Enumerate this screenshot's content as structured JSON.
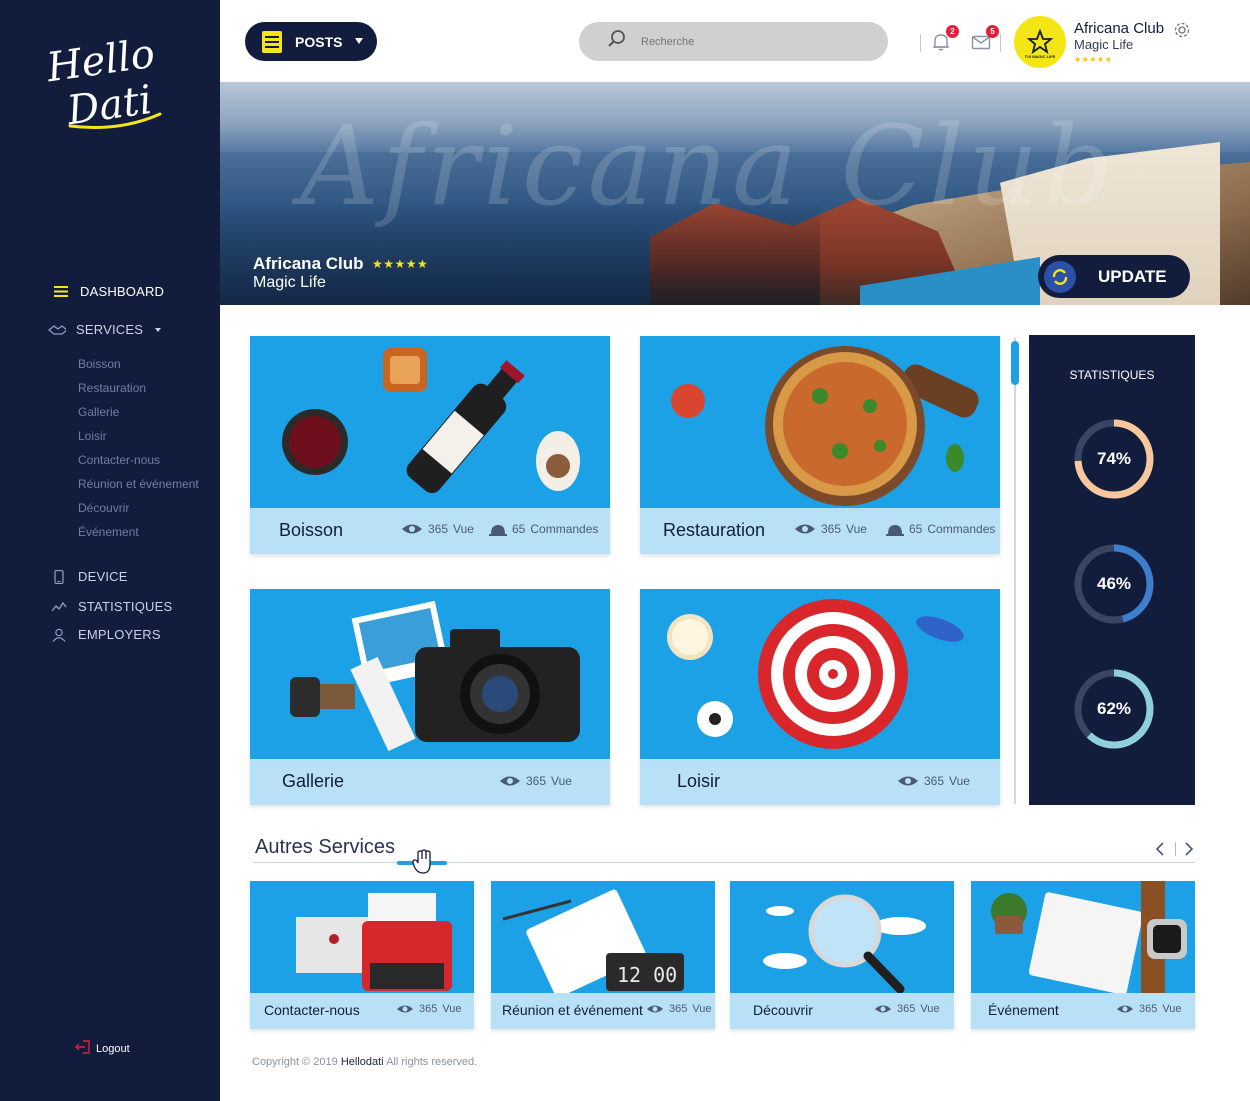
{
  "sidebar": {
    "logo_text": "Hello Dati",
    "nav": [
      {
        "label": "DASHBOARD",
        "icon": "menu-icon"
      },
      {
        "label": "SERVICES",
        "icon": "handshake-icon"
      },
      {
        "label": "DEVICE",
        "icon": "mobile-icon"
      },
      {
        "label": "STATISTIQUES",
        "icon": "chart-line-icon"
      },
      {
        "label": "EMPLOYERS",
        "icon": "user-icon"
      }
    ],
    "services_sub": [
      "Boisson",
      "Restauration",
      "Gallerie",
      "Loisir",
      "Contacter-nous",
      "Réunion et événement",
      "Découvrir",
      "Événement"
    ],
    "logout": "Logout"
  },
  "header": {
    "posts_label": "POSTS",
    "search_placeholder": "Recherche",
    "notifications_count": "2",
    "messages_count": "5",
    "avatar_text": "TUI MAGIC LIFE",
    "club_name": "Africana Club",
    "club_sub": "Magic Life",
    "club_stars": "★★★★★"
  },
  "banner": {
    "watermark": "Africana Club",
    "title": "Africana Club",
    "stars": "★★★★★",
    "subtitle": "Magic Life",
    "update_label": "UPDATE"
  },
  "cards": [
    {
      "title": "Boisson",
      "views": "365",
      "views_unit": "Vue",
      "orders": "65",
      "orders_unit": "Commandes"
    },
    {
      "title": "Restauration",
      "views": "365",
      "views_unit": "Vue",
      "orders": "65",
      "orders_unit": "Commandes"
    },
    {
      "title": "Gallerie",
      "views": "365",
      "views_unit": "Vue"
    },
    {
      "title": "Loisir",
      "views": "365",
      "views_unit": "Vue"
    }
  ],
  "statistiques": {
    "title": "STATISTIQUES",
    "items": [
      {
        "label": "74%",
        "value": 0.74,
        "color": "#f7c89b"
      },
      {
        "label": "46%",
        "value": 0.46,
        "color": "#3d7fcc"
      },
      {
        "label": "62%",
        "value": 0.62,
        "color": "#8fd0dc"
      }
    ]
  },
  "autres": {
    "title": "Autres Services",
    "cards": [
      {
        "title": "Contacter-nous",
        "views": "365",
        "views_unit": "Vue"
      },
      {
        "title": "Réunion et événement",
        "views": "365",
        "views_unit": "Vue",
        "clock": "12 00"
      },
      {
        "title": "Découvrir",
        "views": "365",
        "views_unit": "Vue"
      },
      {
        "title": "Événement",
        "views": "365",
        "views_unit": "Vue"
      }
    ]
  },
  "footer": {
    "copyright_prefix": "Copyright © 2019",
    "brand": "Hellodati",
    "copyright_suffix": "All rights reserved."
  },
  "colors": {
    "sidebar": "#121d3d",
    "accent_yellow": "#f4e616",
    "card_blue": "#1da1e6",
    "card_footer": "#b8e1f7"
  }
}
